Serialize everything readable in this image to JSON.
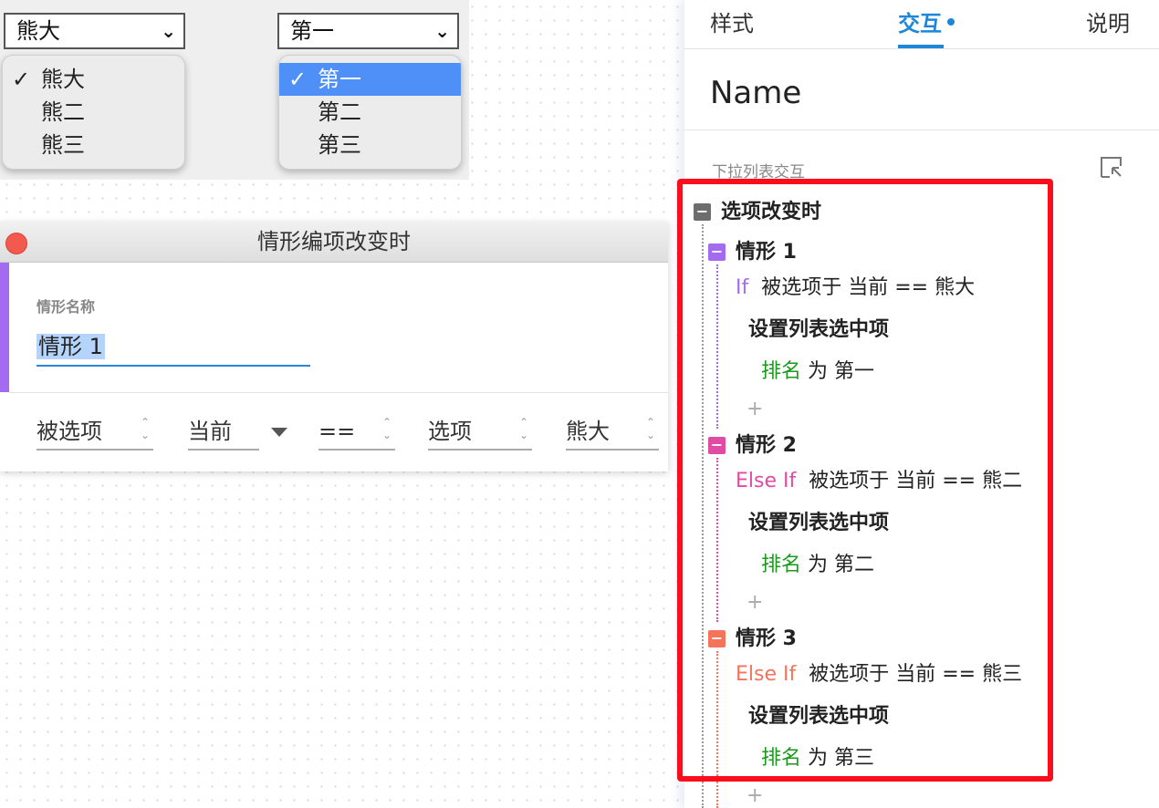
{
  "preview": {
    "dropdown_left": {
      "value": "熊大",
      "options": [
        {
          "label": "熊大",
          "checked": true
        },
        {
          "label": "熊二",
          "checked": false
        },
        {
          "label": "熊三",
          "checked": false
        }
      ]
    },
    "dropdown_right": {
      "value": "第一",
      "options": [
        {
          "label": "第一",
          "checked": true,
          "highlighted": true
        },
        {
          "label": "第二",
          "checked": false
        },
        {
          "label": "第三",
          "checked": false
        }
      ]
    }
  },
  "dialog": {
    "title": "情形编项改变时",
    "case_label": "情形名称",
    "case_name": "情形 1",
    "condition": {
      "target": "被选项",
      "which": "当前",
      "operator": "==",
      "source": "选项",
      "value": "熊大"
    }
  },
  "panel": {
    "tabs": [
      "样式",
      "交互",
      "说明"
    ],
    "active_tab": "交互",
    "name": "Name",
    "section_label": "下拉列表交互",
    "event": "选项改变时",
    "cases": [
      {
        "title": "情形 1",
        "color": "#a36cf0",
        "keyword": "If",
        "condition": "被选项于 当前 == 熊大",
        "action": "设置列表选中项",
        "target": "排名",
        "to": "为",
        "value": "第一"
      },
      {
        "title": "情形 2",
        "color": "#e14ba3",
        "keyword": "Else If",
        "condition": "被选项于 当前 == 熊二",
        "action": "设置列表选中项",
        "target": "排名",
        "to": "为",
        "value": "第二"
      },
      {
        "title": "情形 3",
        "color": "#f4735b",
        "keyword": "Else If",
        "condition": "被选项于 当前 == 熊三",
        "action": "设置列表选中项",
        "target": "排名",
        "to": "为",
        "value": "第三"
      }
    ],
    "add_symbol": "+"
  },
  "colors": {
    "accent_blue": "#1f87da",
    "highlight_red": "#fc0d1b",
    "menu_selected": "#4e90f8",
    "action_green": "#1a9a1a"
  },
  "icons": [
    "check-icon",
    "chevron-down-icon",
    "close-icon",
    "spinner-icon",
    "collapse-all-icon",
    "collapse-square-icon",
    "add-icon"
  ]
}
